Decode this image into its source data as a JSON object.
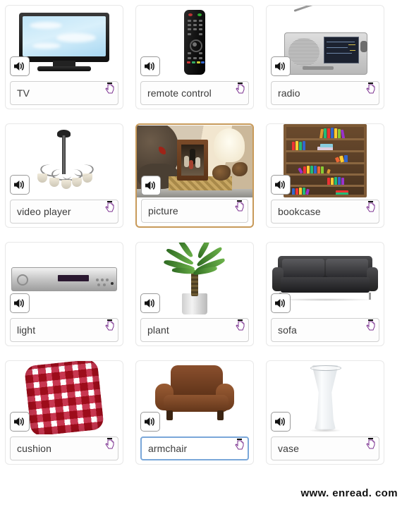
{
  "page": {
    "watermark": "www. enread. com",
    "card_count": 12,
    "columns": 3,
    "accent_border_color": "#c89a5a",
    "focus_border_color": "#7aa7d9",
    "label_text_color": "#3b3b3b"
  },
  "icons": {
    "speaker": "speaker-icon",
    "hand_pointer": "hand-pointer-icon"
  },
  "cards": [
    {
      "label": "TV",
      "art": "tv",
      "state": "normal"
    },
    {
      "label": "remote control",
      "art": "remote",
      "state": "normal"
    },
    {
      "label": "radio",
      "art": "radio",
      "state": "normal"
    },
    {
      "label": "video player",
      "art": "chandelier",
      "state": "normal"
    },
    {
      "label": "picture",
      "art": "picture",
      "state": "accent"
    },
    {
      "label": "bookcase",
      "art": "bookcase",
      "state": "normal"
    },
    {
      "label": "light",
      "art": "dvd",
      "state": "normal"
    },
    {
      "label": "plant",
      "art": "plant",
      "state": "normal"
    },
    {
      "label": "sofa",
      "art": "sofa",
      "state": "normal"
    },
    {
      "label": "cushion",
      "art": "cushion",
      "state": "normal"
    },
    {
      "label": "armchair",
      "art": "armchair",
      "state": "focus"
    },
    {
      "label": "vase",
      "art": "vase",
      "state": "normal"
    }
  ]
}
